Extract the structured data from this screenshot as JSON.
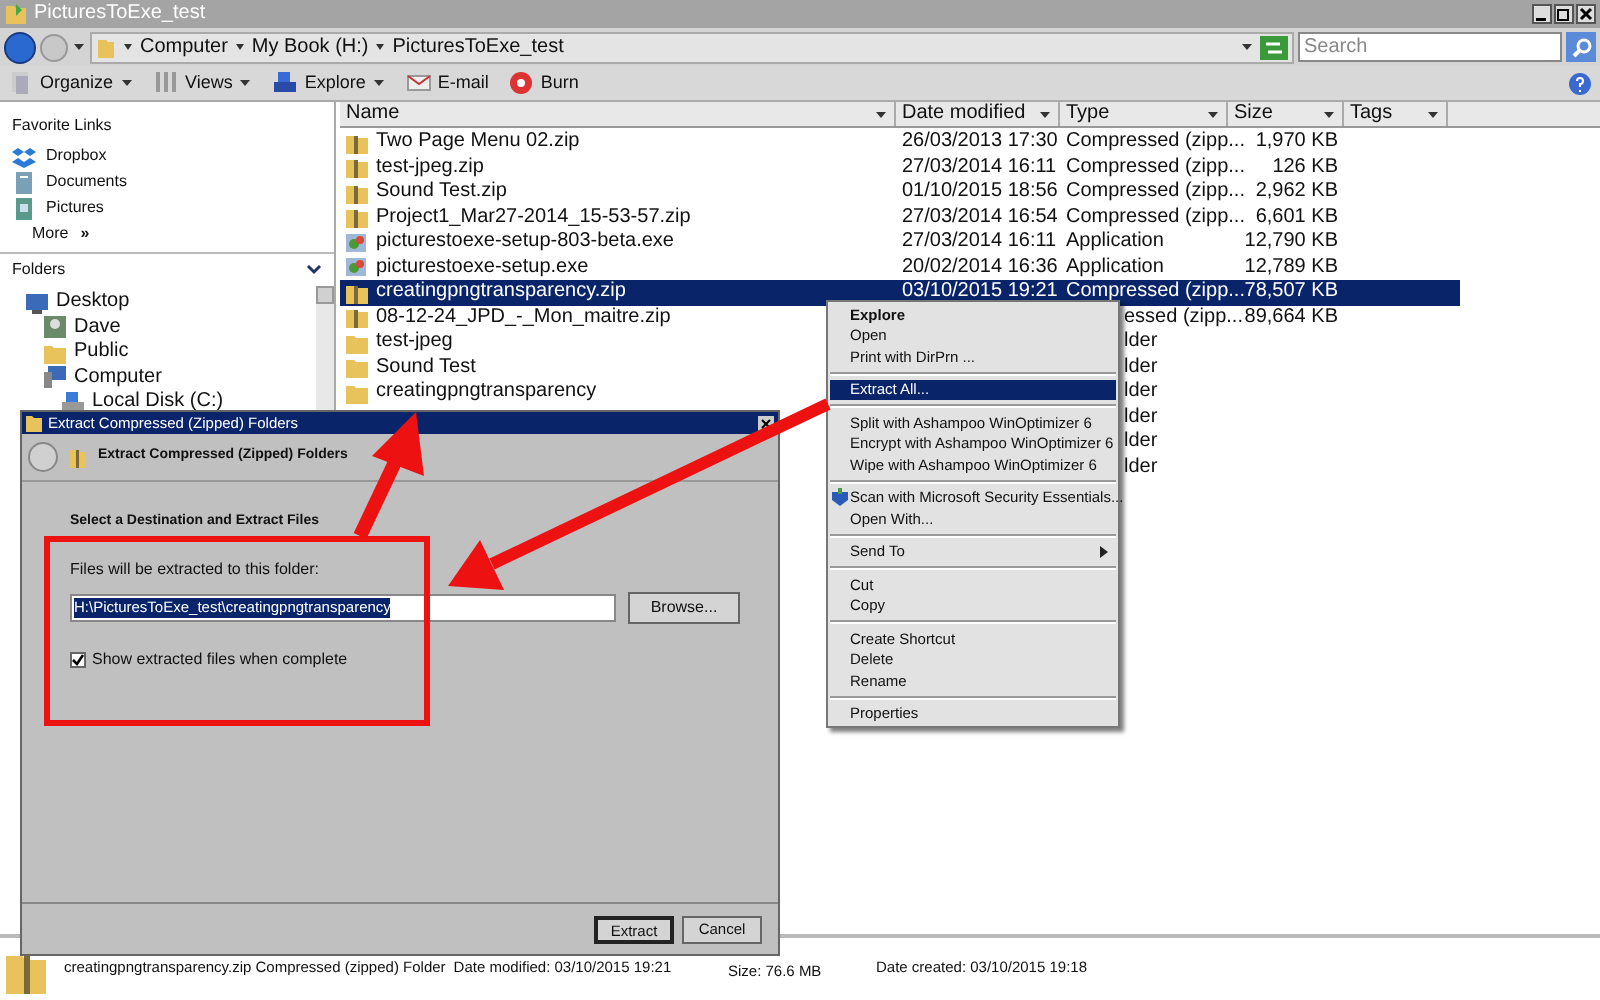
{
  "window": {
    "title": "PicturesToExe_test"
  },
  "address_bar": {
    "crumbs": [
      "Computer",
      "My Book (H:)",
      "PicturesToExe_test"
    ]
  },
  "search": {
    "placeholder": "Search"
  },
  "toolbar": [
    {
      "label": "Organize",
      "kind": "organize",
      "dropdown": true
    },
    {
      "label": "Views",
      "kind": "views",
      "dropdown": true
    },
    {
      "label": "Explore",
      "kind": "explore",
      "dropdown": true
    },
    {
      "label": "E-mail",
      "kind": "email",
      "dropdown": false
    },
    {
      "label": "Burn",
      "kind": "burn",
      "dropdown": false
    }
  ],
  "favorite_links": {
    "title": "Favorite Links",
    "items": [
      {
        "label": "Dropbox",
        "kind": "dropbox"
      },
      {
        "label": "Documents",
        "kind": "documents"
      },
      {
        "label": "Pictures",
        "kind": "pictures"
      }
    ],
    "more": "More",
    "more_glyph": "»"
  },
  "folders": {
    "title": "Folders",
    "tree": [
      {
        "label": "Desktop",
        "kind": "desktop",
        "children": [
          {
            "label": "Dave",
            "kind": "user"
          },
          {
            "label": "Public",
            "kind": "folder"
          },
          {
            "label": "Computer",
            "kind": "computer",
            "children": [
              {
                "label": "Local Disk (C:)",
                "kind": "disk"
              }
            ]
          }
        ]
      }
    ]
  },
  "file_list": {
    "columns": [
      "Name",
      "Date modified",
      "Type",
      "Size",
      "Tags"
    ],
    "rows": [
      {
        "name": "Two Page Menu 02.zip",
        "kind": "zip",
        "date": "26/03/2013 17:30",
        "type": "Compressed (zipp...",
        "size": "1,970 KB",
        "selected": false
      },
      {
        "name": "test-jpeg.zip",
        "kind": "zip",
        "date": "27/03/2014 16:11",
        "type": "Compressed (zipp...",
        "size": "126 KB",
        "selected": false
      },
      {
        "name": "Sound Test.zip",
        "kind": "zip",
        "date": "01/10/2015 18:56",
        "type": "Compressed (zipp...",
        "size": "2,962 KB",
        "selected": false
      },
      {
        "name": "Project1_Mar27-2014_15-53-57.zip",
        "kind": "zip",
        "date": "27/03/2014 16:54",
        "type": "Compressed (zipp...",
        "size": "6,601 KB",
        "selected": false
      },
      {
        "name": "picturestoexe-setup-803-beta.exe",
        "kind": "exe",
        "date": "27/03/2014 16:11",
        "type": "Application",
        "size": "12,790 KB",
        "selected": false
      },
      {
        "name": "picturestoexe-setup.exe",
        "kind": "exe",
        "date": "20/02/2014 16:36",
        "type": "Application",
        "size": "12,789 KB",
        "selected": false
      },
      {
        "name": "creatingpngtransparency.zip",
        "kind": "zip",
        "date": "03/10/2015 19:21",
        "type": "Compressed (zipp...",
        "size": "78,507 KB",
        "selected": true
      },
      {
        "name": "08-12-24_JPD_-_Mon_maitre.zip",
        "kind": "zip",
        "type": "essed (zipp...",
        "size": "89,664 KB",
        "selected": false
      },
      {
        "name": "test-jpeg",
        "kind": "folder",
        "type": "lder",
        "selected": false
      },
      {
        "name": "Sound Test",
        "kind": "folder",
        "type": "lder",
        "selected": false
      },
      {
        "name": "creatingpngtransparency",
        "kind": "folder",
        "type": "lder",
        "selected": false
      },
      {
        "type": "lder",
        "selected": false
      },
      {
        "type": "lder",
        "selected": false
      },
      {
        "type": "lder",
        "selected": false
      }
    ]
  },
  "context_menu": {
    "groups": [
      [
        {
          "label": "Explore",
          "default": true,
          "selected": false
        },
        {
          "label": "Open",
          "default": false,
          "selected": false
        },
        {
          "label": "Print with DirPrn ...",
          "default": false,
          "selected": false
        }
      ],
      [
        {
          "label": "Extract All...",
          "default": false,
          "selected": true
        }
      ],
      [
        {
          "label": "Split with Ashampoo WinOptimizer 6",
          "default": false,
          "selected": false
        },
        {
          "label": "Encrypt with Ashampoo WinOptimizer 6",
          "default": false,
          "selected": false
        },
        {
          "label": "Wipe with Ashampoo WinOptimizer 6",
          "default": false,
          "selected": false
        }
      ],
      [
        {
          "label": "Scan with Microsoft Security Essentials...",
          "default": false,
          "selected": false,
          "kind": "scan"
        },
        {
          "label": "Open With...",
          "default": false,
          "selected": false
        }
      ],
      [
        {
          "label": "Send To",
          "default": false,
          "selected": false,
          "submenu": true
        }
      ],
      [
        {
          "label": "Cut",
          "default": false,
          "selected": false
        },
        {
          "label": "Copy",
          "default": false,
          "selected": false
        }
      ],
      [
        {
          "label": "Create Shortcut",
          "default": false,
          "selected": false
        },
        {
          "label": "Delete",
          "default": false,
          "selected": false
        },
        {
          "label": "Rename",
          "default": false,
          "selected": false
        }
      ],
      [
        {
          "label": "Properties",
          "default": false,
          "selected": false
        }
      ]
    ]
  },
  "dialog": {
    "title": "Extract Compressed (Zipped) Folders",
    "heading": "Extract Compressed (Zipped) Folders",
    "section": "Select a Destination and Extract Files",
    "field_label": "Files will be extracted to this folder:",
    "path": "H:\\PicturesToExe_test\\creatingpngtransparency",
    "browse": "Browse...",
    "checkbox": {
      "label": "Show extracted files when complete",
      "checked": true
    },
    "buttons": [
      "Extract",
      "Cancel"
    ]
  },
  "status_bar": {
    "name": "creatingpngtransparency.zip Compressed (zipped) Folder",
    "date_modified": "Date modified: 03/10/2015 19:21",
    "size": "Size: 76.6 MB",
    "date_created": "Date created: 03/10/2015 19:18"
  }
}
